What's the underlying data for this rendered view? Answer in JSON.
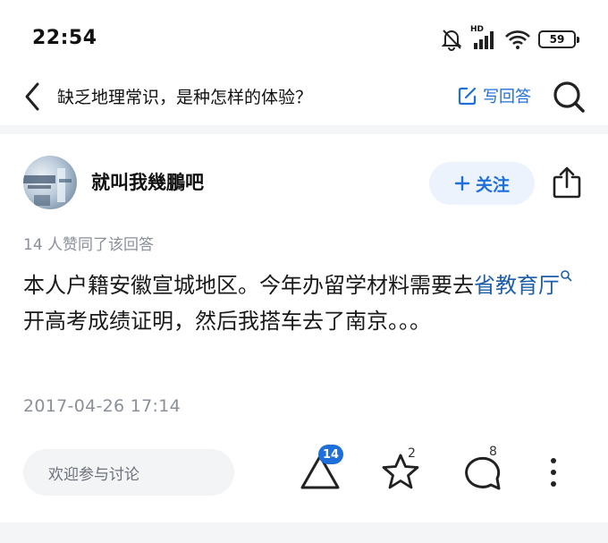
{
  "status_bar": {
    "time": "22:54",
    "network_label": "HD",
    "battery_level": "59",
    "icons": [
      "bell-muted-icon",
      "signal-icon",
      "wifi-icon",
      "battery-icon"
    ]
  },
  "nav": {
    "title": "缺乏地理常识，是种怎样的体验？",
    "write_answer_label": "写回答",
    "icons": [
      "back-arrow-icon",
      "edit-icon",
      "search-icon"
    ]
  },
  "author": {
    "name": "就叫我幾鵬吧",
    "follow_label": "关注"
  },
  "answer": {
    "likes_text": "14 人赞同了该回答",
    "body_before": "本人户籍安徽宣城地区。今年办留学材料需要去",
    "body_link": "省教育厅",
    "body_after": "开高考成绩证明，然后我搭车去了南京。。。",
    "timestamp": "2017-04-26 17:14"
  },
  "actions": {
    "comment_placeholder": "欢迎参与讨论",
    "upvote_count": "14",
    "star_count": "2",
    "comment_count": "8"
  },
  "colors": {
    "accent": "#1e6fd9",
    "link": "#1e5ea8",
    "muted_text": "#8a8f99",
    "follow_bg": "#ecf3fd"
  }
}
